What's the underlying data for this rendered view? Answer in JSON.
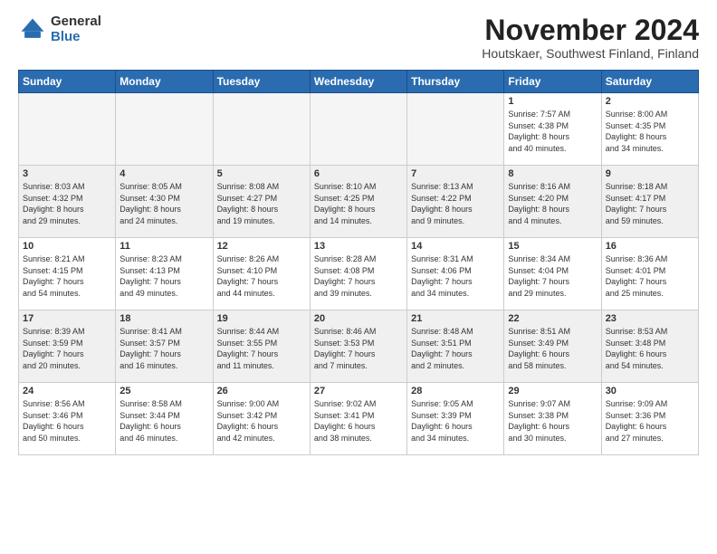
{
  "logo": {
    "general": "General",
    "blue": "Blue"
  },
  "title": "November 2024",
  "location": "Houtskaer, Southwest Finland, Finland",
  "days_of_week": [
    "Sunday",
    "Monday",
    "Tuesday",
    "Wednesday",
    "Thursday",
    "Friday",
    "Saturday"
  ],
  "weeks": [
    [
      {
        "day": "",
        "info": "",
        "empty": true
      },
      {
        "day": "",
        "info": "",
        "empty": true
      },
      {
        "day": "",
        "info": "",
        "empty": true
      },
      {
        "day": "",
        "info": "",
        "empty": true
      },
      {
        "day": "",
        "info": "",
        "empty": true
      },
      {
        "day": "1",
        "info": "Sunrise: 7:57 AM\nSunset: 4:38 PM\nDaylight: 8 hours\nand 40 minutes."
      },
      {
        "day": "2",
        "info": "Sunrise: 8:00 AM\nSunset: 4:35 PM\nDaylight: 8 hours\nand 34 minutes."
      }
    ],
    [
      {
        "day": "3",
        "info": "Sunrise: 8:03 AM\nSunset: 4:32 PM\nDaylight: 8 hours\nand 29 minutes."
      },
      {
        "day": "4",
        "info": "Sunrise: 8:05 AM\nSunset: 4:30 PM\nDaylight: 8 hours\nand 24 minutes."
      },
      {
        "day": "5",
        "info": "Sunrise: 8:08 AM\nSunset: 4:27 PM\nDaylight: 8 hours\nand 19 minutes."
      },
      {
        "day": "6",
        "info": "Sunrise: 8:10 AM\nSunset: 4:25 PM\nDaylight: 8 hours\nand 14 minutes."
      },
      {
        "day": "7",
        "info": "Sunrise: 8:13 AM\nSunset: 4:22 PM\nDaylight: 8 hours\nand 9 minutes."
      },
      {
        "day": "8",
        "info": "Sunrise: 8:16 AM\nSunset: 4:20 PM\nDaylight: 8 hours\nand 4 minutes."
      },
      {
        "day": "9",
        "info": "Sunrise: 8:18 AM\nSunset: 4:17 PM\nDaylight: 7 hours\nand 59 minutes."
      }
    ],
    [
      {
        "day": "10",
        "info": "Sunrise: 8:21 AM\nSunset: 4:15 PM\nDaylight: 7 hours\nand 54 minutes."
      },
      {
        "day": "11",
        "info": "Sunrise: 8:23 AM\nSunset: 4:13 PM\nDaylight: 7 hours\nand 49 minutes."
      },
      {
        "day": "12",
        "info": "Sunrise: 8:26 AM\nSunset: 4:10 PM\nDaylight: 7 hours\nand 44 minutes."
      },
      {
        "day": "13",
        "info": "Sunrise: 8:28 AM\nSunset: 4:08 PM\nDaylight: 7 hours\nand 39 minutes."
      },
      {
        "day": "14",
        "info": "Sunrise: 8:31 AM\nSunset: 4:06 PM\nDaylight: 7 hours\nand 34 minutes."
      },
      {
        "day": "15",
        "info": "Sunrise: 8:34 AM\nSunset: 4:04 PM\nDaylight: 7 hours\nand 29 minutes."
      },
      {
        "day": "16",
        "info": "Sunrise: 8:36 AM\nSunset: 4:01 PM\nDaylight: 7 hours\nand 25 minutes."
      }
    ],
    [
      {
        "day": "17",
        "info": "Sunrise: 8:39 AM\nSunset: 3:59 PM\nDaylight: 7 hours\nand 20 minutes."
      },
      {
        "day": "18",
        "info": "Sunrise: 8:41 AM\nSunset: 3:57 PM\nDaylight: 7 hours\nand 16 minutes."
      },
      {
        "day": "19",
        "info": "Sunrise: 8:44 AM\nSunset: 3:55 PM\nDaylight: 7 hours\nand 11 minutes."
      },
      {
        "day": "20",
        "info": "Sunrise: 8:46 AM\nSunset: 3:53 PM\nDaylight: 7 hours\nand 7 minutes."
      },
      {
        "day": "21",
        "info": "Sunrise: 8:48 AM\nSunset: 3:51 PM\nDaylight: 7 hours\nand 2 minutes."
      },
      {
        "day": "22",
        "info": "Sunrise: 8:51 AM\nSunset: 3:49 PM\nDaylight: 6 hours\nand 58 minutes."
      },
      {
        "day": "23",
        "info": "Sunrise: 8:53 AM\nSunset: 3:48 PM\nDaylight: 6 hours\nand 54 minutes."
      }
    ],
    [
      {
        "day": "24",
        "info": "Sunrise: 8:56 AM\nSunset: 3:46 PM\nDaylight: 6 hours\nand 50 minutes."
      },
      {
        "day": "25",
        "info": "Sunrise: 8:58 AM\nSunset: 3:44 PM\nDaylight: 6 hours\nand 46 minutes."
      },
      {
        "day": "26",
        "info": "Sunrise: 9:00 AM\nSunset: 3:42 PM\nDaylight: 6 hours\nand 42 minutes."
      },
      {
        "day": "27",
        "info": "Sunrise: 9:02 AM\nSunset: 3:41 PM\nDaylight: 6 hours\nand 38 minutes."
      },
      {
        "day": "28",
        "info": "Sunrise: 9:05 AM\nSunset: 3:39 PM\nDaylight: 6 hours\nand 34 minutes."
      },
      {
        "day": "29",
        "info": "Sunrise: 9:07 AM\nSunset: 3:38 PM\nDaylight: 6 hours\nand 30 minutes."
      },
      {
        "day": "30",
        "info": "Sunrise: 9:09 AM\nSunset: 3:36 PM\nDaylight: 6 hours\nand 27 minutes."
      }
    ]
  ]
}
